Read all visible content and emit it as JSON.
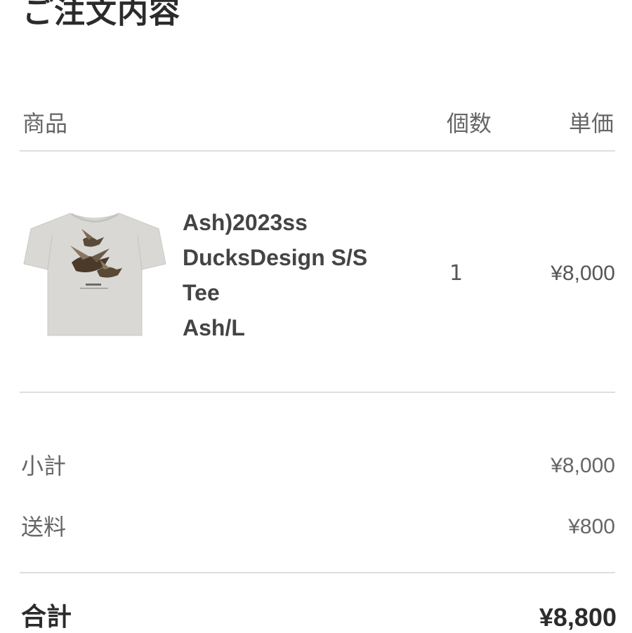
{
  "title": "ご注文内容",
  "table_header": {
    "product": "商品",
    "quantity": "個数",
    "unit_price": "単価"
  },
  "item": {
    "image_icon": "tshirt-ducks-image",
    "name_lines": [
      "Ash)2023ss",
      "DucksDesign S/S",
      "Tee",
      "Ash/L"
    ],
    "quantity": "1",
    "unit_price": "¥8,000"
  },
  "summary": {
    "subtotal_label": "小計",
    "subtotal_value": "¥8,000",
    "shipping_label": "送料",
    "shipping_value": "¥800",
    "total_label": "合計",
    "total_value": "¥8,800"
  },
  "colors": {
    "shirt": "#d9d8d5",
    "divider": "#dedede",
    "text": "#333333"
  }
}
